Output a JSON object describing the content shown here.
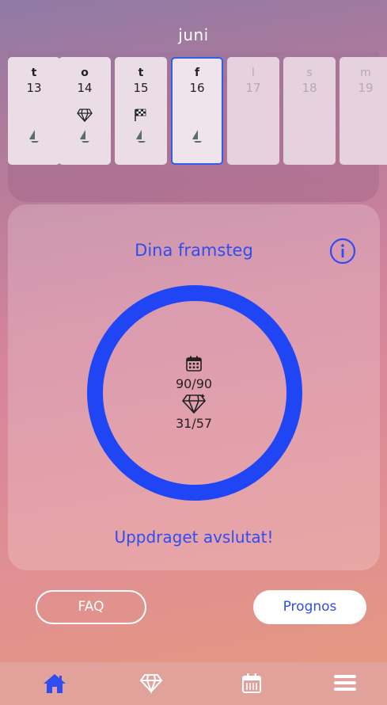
{
  "header": {
    "month": "juni"
  },
  "days": [
    {
      "weekday": "t",
      "date": "13",
      "state": "past",
      "icons": [
        "drop-icon"
      ]
    },
    {
      "weekday": "o",
      "date": "14",
      "state": "past",
      "icons": [
        "diamond-icon",
        "drop-icon"
      ]
    },
    {
      "weekday": "t",
      "date": "15",
      "state": "past",
      "icons": [
        "flag-icon",
        "drop-icon"
      ]
    },
    {
      "weekday": "f",
      "date": "16",
      "state": "selected",
      "icons": [
        "drop-icon"
      ]
    },
    {
      "weekday": "l",
      "date": "17",
      "state": "future",
      "icons": []
    },
    {
      "weekday": "s",
      "date": "18",
      "state": "future",
      "icons": []
    },
    {
      "weekday": "m",
      "date": "19",
      "state": "future",
      "icons": []
    }
  ],
  "progress": {
    "title": "Dina framsteg",
    "days_count": "90/90",
    "diamonds_count": "31/57",
    "ring_fraction": 1.0,
    "status": "Uppdraget avslutat!"
  },
  "buttons": {
    "faq": "FAQ",
    "prognos": "Prognos"
  },
  "bottom_nav": [
    "home-icon",
    "diamond-icon",
    "calendar-icon",
    "menu-icon"
  ],
  "colors": {
    "accent": "#2f4df0",
    "ring": "#1f45f5"
  }
}
